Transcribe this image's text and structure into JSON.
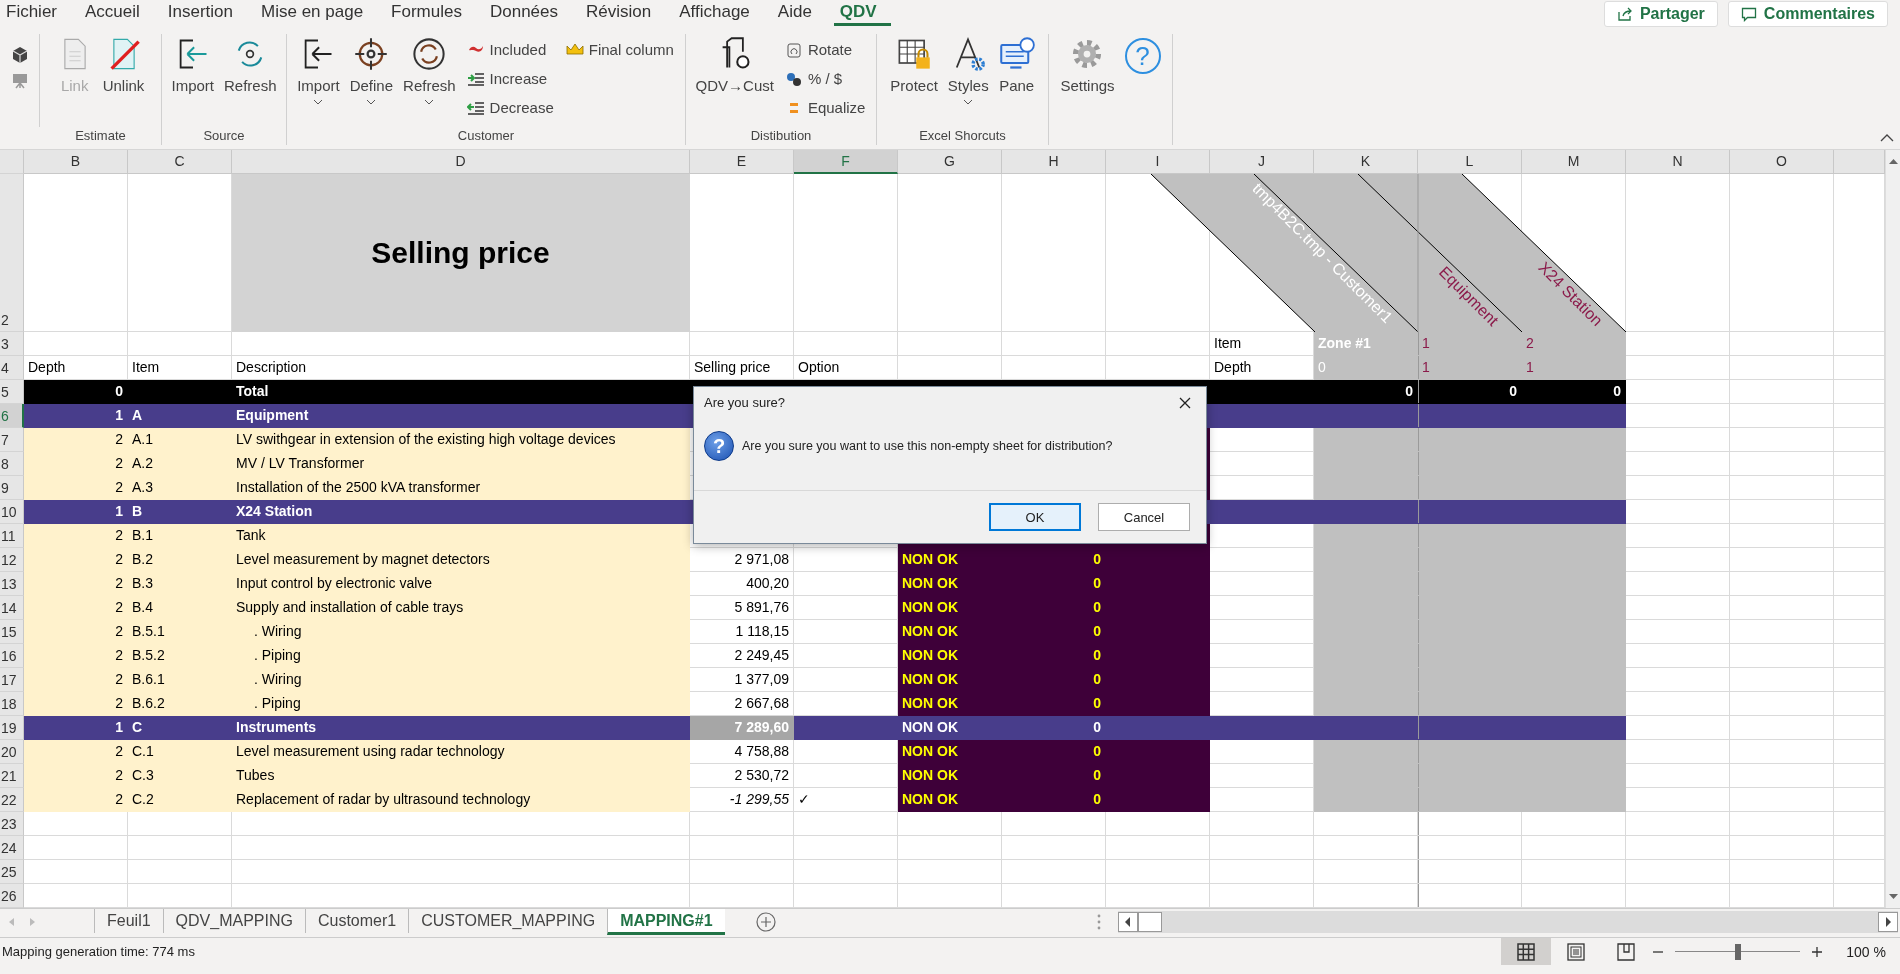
{
  "menu_tabs": [
    {
      "label": "Fichier",
      "selected": false
    },
    {
      "label": "Accueil",
      "selected": false
    },
    {
      "label": "Insertion",
      "selected": false
    },
    {
      "label": "Mise en page",
      "selected": false
    },
    {
      "label": "Formules",
      "selected": false
    },
    {
      "label": "Données",
      "selected": false
    },
    {
      "label": "Révision",
      "selected": false
    },
    {
      "label": "Affichage",
      "selected": false
    },
    {
      "label": "Aide",
      "selected": false
    },
    {
      "label": "QDV",
      "selected": true
    }
  ],
  "share_buttons": [
    "Partager",
    "Commentaires"
  ],
  "ribbon_groups": [
    {
      "label": "Estimate",
      "items": [
        {
          "label": "Link",
          "kind": "large",
          "disabled": true
        },
        {
          "label": "Unlink",
          "kind": "large",
          "disabled": false
        }
      ]
    },
    {
      "label": "Source",
      "items": [
        {
          "label": "Import",
          "kind": "large",
          "disabled": false
        },
        {
          "label": "Refresh",
          "kind": "large",
          "disabled": false
        }
      ]
    },
    {
      "label": "Customer",
      "items": [
        {
          "label": "Import",
          "kind": "large",
          "disabled": false,
          "dropdown": true
        },
        {
          "label": "Define",
          "kind": "large",
          "disabled": false,
          "dropdown": true
        },
        {
          "label": "Refresh",
          "kind": "large",
          "disabled": false,
          "dropdown": true
        },
        {
          "label": "Included",
          "kind": "small",
          "disabled": false
        },
        {
          "label": "Increase",
          "kind": "small",
          "disabled": false
        },
        {
          "label": "Decrease",
          "kind": "small",
          "disabled": false
        },
        {
          "label": "Final column",
          "kind": "small",
          "disabled": false
        }
      ]
    },
    {
      "label": "Distibution",
      "items": [
        {
          "label": "QDV→Cust",
          "kind": "large",
          "disabled": false
        },
        {
          "label": "Rotate",
          "kind": "small",
          "disabled": false
        },
        {
          "label": "% / $",
          "kind": "small",
          "disabled": false
        },
        {
          "label": "Equalize",
          "kind": "small",
          "disabled": false
        }
      ]
    },
    {
      "label": "Excel Shorcuts",
      "items": [
        {
          "label": "Protect",
          "kind": "large",
          "disabled": false
        },
        {
          "label": "Styles",
          "kind": "large",
          "disabled": false,
          "dropdown": true
        },
        {
          "label": "Pane",
          "kind": "large",
          "disabled": false
        }
      ]
    },
    {
      "items": [
        {
          "label": "Settings",
          "kind": "large",
          "disabled": false
        },
        {
          "kind": "help",
          "glyph": "?"
        }
      ]
    }
  ],
  "columns": [
    {
      "label": "B",
      "selected": false
    },
    {
      "label": "C",
      "selected": false
    },
    {
      "label": "D",
      "selected": false
    },
    {
      "label": "E",
      "selected": false
    },
    {
      "label": "F",
      "selected": true
    },
    {
      "label": "G",
      "selected": false
    },
    {
      "label": "H",
      "selected": false
    },
    {
      "label": "I",
      "selected": false
    },
    {
      "label": "J",
      "selected": false
    },
    {
      "label": "K",
      "selected": false
    },
    {
      "label": "L",
      "selected": false
    },
    {
      "label": "M",
      "selected": false
    },
    {
      "label": "N",
      "selected": false
    },
    {
      "label": "O",
      "selected": false
    }
  ],
  "zone_headers": [
    "tmp4B2C.tmp - Customer1",
    "Equipment",
    "X24 Station"
  ],
  "rows": [
    {
      "number": "2",
      "kind": "title",
      "selected": false,
      "description": "Selling price"
    },
    {
      "number": "3",
      "kind": "zone-title",
      "selected": false,
      "row_label": "Item",
      "zone": "Zone #1",
      "equipment": "1",
      "x24_station": "2"
    },
    {
      "number": "4",
      "kind": "columns",
      "selected": false,
      "depth": "Depth",
      "item": "Item",
      "description": "Description",
      "price": "Selling price",
      "option": "Option",
      "row_label": "Depth",
      "zone": "0",
      "equipment": "1",
      "x24_station": "1"
    },
    {
      "number": "5",
      "kind": "total",
      "selected": false,
      "depth": "0",
      "description": "Total",
      "zone": "0",
      "equipment": "0",
      "x24_station": "0"
    },
    {
      "number": "6",
      "kind": "group",
      "selected": true,
      "depth": "1",
      "item": "A",
      "description": "Equipment"
    },
    {
      "number": "7",
      "kind": "item",
      "selected": false,
      "depth": "2",
      "item": "A.1",
      "description": "LV swithgear in extension of the existing high voltage devices"
    },
    {
      "number": "8",
      "kind": "item",
      "selected": false,
      "depth": "2",
      "item": "A.2",
      "description": "MV / LV Transformer"
    },
    {
      "number": "9",
      "kind": "item",
      "selected": false,
      "depth": "2",
      "item": "A.3",
      "description": "Installation of the 2500 kVA transformer"
    },
    {
      "number": "10",
      "kind": "group",
      "selected": false,
      "depth": "1",
      "item": "B",
      "description": "X24 Station"
    },
    {
      "number": "11",
      "kind": "item",
      "selected": false,
      "depth": "2",
      "item": "B.1",
      "description": "Tank"
    },
    {
      "number": "12",
      "kind": "item",
      "selected": false,
      "depth": "2",
      "item": "B.2",
      "description": "Level measurement by magnet detectors",
      "price": "2 971,08",
      "status": "NON OK",
      "value": "0"
    },
    {
      "number": "13",
      "kind": "item",
      "selected": false,
      "depth": "2",
      "item": "B.3",
      "description": "Input control by electronic valve",
      "price": "400,20",
      "status": "NON OK",
      "value": "0"
    },
    {
      "number": "14",
      "kind": "item",
      "selected": false,
      "depth": "2",
      "item": "B.4",
      "description": "Supply and installation of cable trays",
      "price": "5 891,76",
      "status": "NON OK",
      "value": "0"
    },
    {
      "number": "15",
      "kind": "subitem",
      "selected": false,
      "depth": "2",
      "item": "B.5.1",
      "description": ". Wiring",
      "price": "1 118,15",
      "status": "NON OK",
      "value": "0"
    },
    {
      "number": "16",
      "kind": "subitem",
      "selected": false,
      "depth": "2",
      "item": "B.5.2",
      "description": ". Piping",
      "price": "2 249,45",
      "status": "NON OK",
      "value": "0"
    },
    {
      "number": "17",
      "kind": "subitem",
      "selected": false,
      "depth": "2",
      "item": "B.6.1",
      "description": ". Wiring",
      "price": "1 377,09",
      "status": "NON OK",
      "value": "0"
    },
    {
      "number": "18",
      "kind": "subitem",
      "selected": false,
      "depth": "2",
      "item": "B.6.2",
      "description": ". Piping",
      "price": "2 667,68",
      "status": "NON OK",
      "value": "0"
    },
    {
      "number": "19",
      "kind": "group",
      "selected": false,
      "depth": "1",
      "item": "C",
      "description": "Instruments",
      "price": "7 289,60",
      "status": "NON OK",
      "value": "0"
    },
    {
      "number": "20",
      "kind": "item",
      "selected": false,
      "depth": "2",
      "item": "C.1",
      "description": "Level measurement using radar technology",
      "price": "4 758,88",
      "status": "NON OK",
      "value": "0"
    },
    {
      "number": "21",
      "kind": "item",
      "selected": false,
      "depth": "2",
      "item": "C.3",
      "description": "Tubes",
      "price": "2 530,72",
      "status": "NON OK",
      "value": "0"
    },
    {
      "number": "22",
      "kind": "item",
      "selected": false,
      "depth": "2",
      "item": "C.2",
      "description": "Replacement of radar by ultrasound technology",
      "price": "-1 299,55",
      "price_italic": true,
      "option": "✓",
      "status": "NON OK",
      "value": "0"
    },
    {
      "number": "23",
      "kind": "blank",
      "selected": false
    },
    {
      "number": "24",
      "kind": "blank",
      "selected": false
    },
    {
      "number": "25",
      "kind": "blank",
      "selected": false
    },
    {
      "number": "26",
      "kind": "blank",
      "selected": false
    }
  ],
  "dialog": {
    "title": "Are you sure?",
    "icon_glyph": "?",
    "message": "Are you sure you want to use this non-empty sheet for distribution?",
    "buttons": [
      {
        "label": "OK",
        "default": true
      },
      {
        "label": "Cancel",
        "default": false
      }
    ]
  },
  "sheet_tabs": [
    {
      "label": "Feuil1",
      "selected": false
    },
    {
      "label": "QDV_MAPPING",
      "selected": false
    },
    {
      "label": "Customer1",
      "selected": false
    },
    {
      "label": "CUSTOMER_MAPPING",
      "selected": false
    },
    {
      "label": "MAPPING#1",
      "selected": true
    }
  ],
  "status_bar": {
    "message": "Mapping generation time: 774 ms",
    "views": [
      {
        "selected": true
      },
      {
        "selected": false
      },
      {
        "selected": false
      }
    ],
    "zoom": {
      "level": 0.5,
      "label": "100 %"
    }
  }
}
